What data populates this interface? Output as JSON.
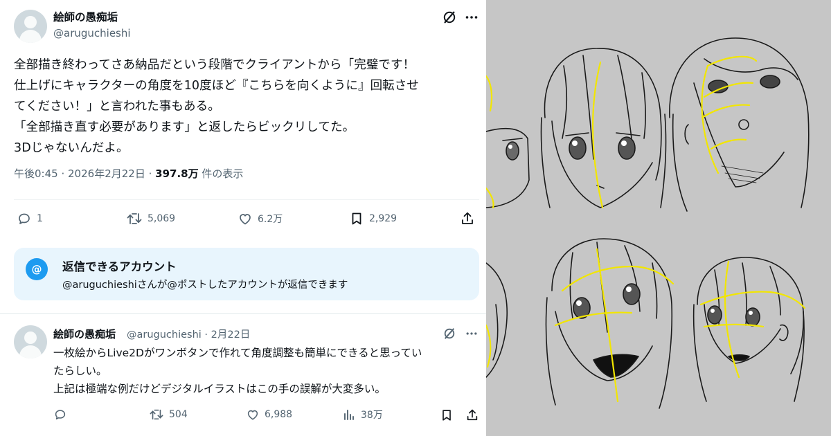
{
  "post": {
    "display_name": "絵師の愚痴垢",
    "handle": "@aruguchieshi",
    "text": "全部描き終わってさあ納品だという段階でクライアントから「完璧です！\n仕上げにキャラクターの角度を10度ほど『こちらを向くように』回転させ\nてください！」と言われた事もある。\n「全部描き直す必要があります」と返したらビックリしてた。\n3Dじゃないんだよ。",
    "time": "午後0:45",
    "date": "2026年2月22日",
    "views": "397.8万",
    "views_suffix": "件の表示",
    "actions": {
      "replies": "1",
      "reposts": "5,069",
      "likes": "6.2万",
      "bookmarks": "2,929"
    }
  },
  "reply_settings": {
    "title": "返信できるアカウント",
    "description": "@aruguchieshiさんが@ポストしたアカウントが返信できます",
    "icon": "at-icon"
  },
  "reply": {
    "display_name": "絵師の愚痴垢",
    "handle_date": "@aruguchieshi · 2月22日",
    "text": "一枚絵からLive2Dがワンボタンで作れて角度調整も簡単にできると思ってい\nたらしい。\n上記は極端な例だけどデジタルイラストはこの手の誤解が大変多い。",
    "actions": {
      "replies": "",
      "reposts": "504",
      "likes": "6,988",
      "views": "38万"
    }
  },
  "colors": {
    "text": "#0f1419",
    "secondary": "#536471",
    "accent": "#1d9bf0",
    "reply_box_bg": "#e8f5fd",
    "art_bg": "#c6c6c6",
    "guide_lines": "#f2e600"
  },
  "icons": [
    "grok-icon",
    "more-icon",
    "reply-icon",
    "repost-icon",
    "like-icon",
    "bookmark-icon",
    "share-icon",
    "views-icon",
    "at-icon"
  ]
}
